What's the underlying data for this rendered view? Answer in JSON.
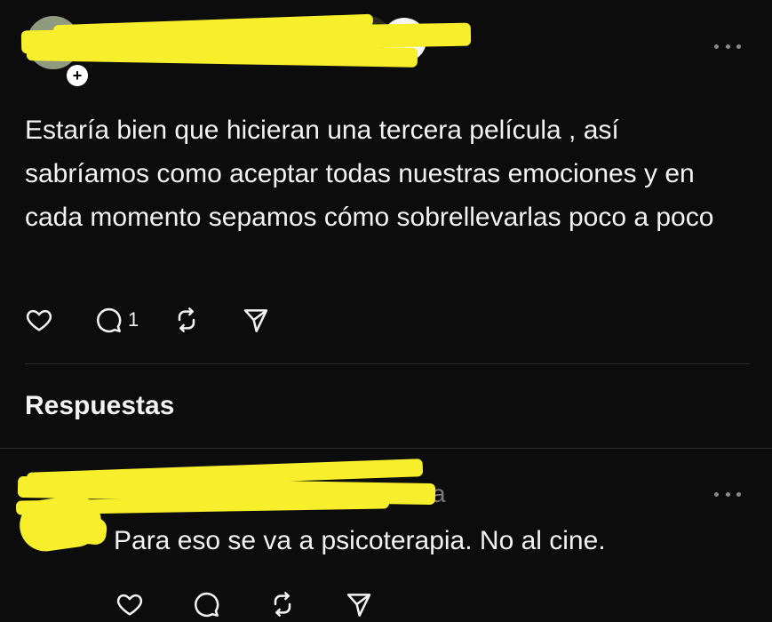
{
  "post": {
    "body": "Estaría bien que hicieran una tercera película , así sabríamos como aceptar todas nuestras emociones y en cada momento sepamos cómo sobrellevarlas poco a poco",
    "follow_badge": "+",
    "actions": {
      "like_icon": "heart-icon",
      "reply_icon": "comment-icon",
      "reply_count": "1",
      "repost_icon": "repost-icon",
      "share_icon": "send-icon"
    },
    "more_icon": "more-options-icon"
  },
  "replies_section": {
    "title": "Respuestas"
  },
  "reply": {
    "time": "ahora",
    "text": "Para eso se va a psicoterapia. No al cine.",
    "more_icon": "more-options-icon"
  },
  "colors": {
    "background": "#0c0c0c",
    "text": "#f2f2f2",
    "muted": "#7c7c7c",
    "redaction": "#f7ee2c"
  }
}
